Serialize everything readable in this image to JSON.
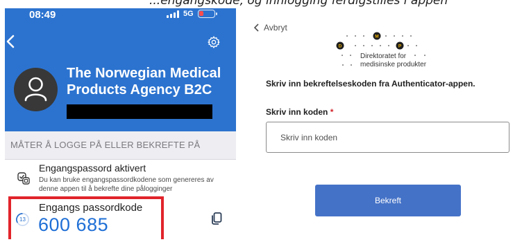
{
  "caption": "...engangskode, og innlogging ferdigstilles i appen",
  "phone": {
    "status": {
      "time": "08:49",
      "network": "5G"
    },
    "app_title": "The Norwegian Medical Products Agency B2C",
    "section_header": "MÅTER Å LOGGE PÅ ELLER BEKREFTE PÅ",
    "otp_row": {
      "title": "Engangspassord aktivert",
      "description": "Du kan bruke engangspassordkodene som genereres av denne appen til å bekrefte dine pålogginger"
    },
    "code_row": {
      "label": "Engangs passordkode",
      "code": "600 685",
      "timer": "13"
    }
  },
  "form": {
    "cancel_label": "Avbryt",
    "logo": {
      "line1": "Direktoratet for",
      "line2": "medisinske produkter",
      "letters": [
        "M",
        "D",
        "P"
      ]
    },
    "instruction": "Skriv inn bekreftelseskoden fra Authenticator-appen.",
    "field_label": "Skriv inn koden",
    "required_marker": "*",
    "input_placeholder": "Skriv inn koden",
    "input_value": "",
    "submit_label": "Bekreft"
  },
  "colors": {
    "phone_blue": "#2c73cf",
    "code_blue": "#1f6fd6",
    "highlight_red": "#e1242b",
    "button_blue": "#4472c7"
  }
}
